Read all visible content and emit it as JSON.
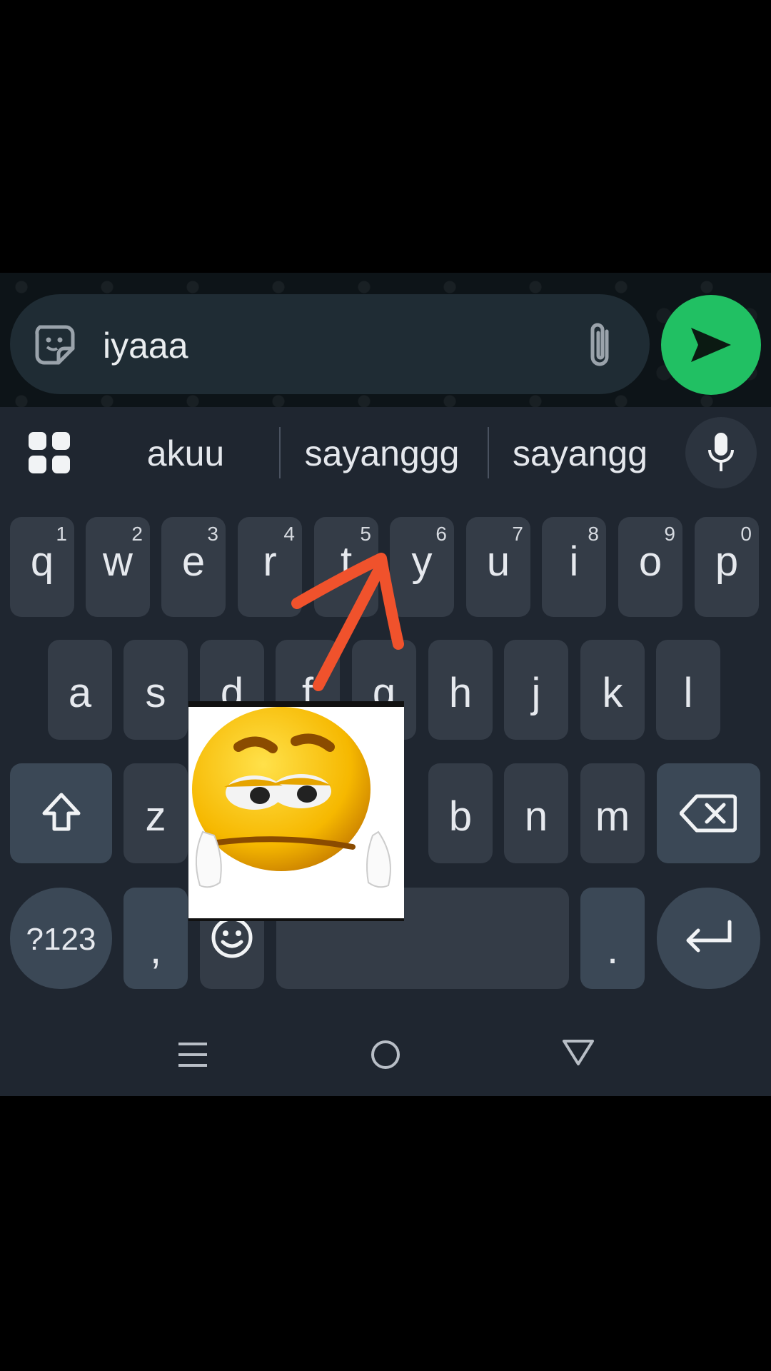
{
  "composer": {
    "message_text": "iyaaa",
    "sticker_icon": "sticker-icon",
    "attach_icon": "paperclip-icon",
    "send_icon": "send-icon",
    "send_color": "#21c063"
  },
  "suggestions": {
    "apps_icon": "apps-grid-icon",
    "items": [
      "akuu",
      "sayanggg",
      "sayangg"
    ],
    "mic_icon": "microphone-icon"
  },
  "keyboard": {
    "row1": [
      {
        "char": "q",
        "num": "1"
      },
      {
        "char": "w",
        "num": "2"
      },
      {
        "char": "e",
        "num": "3"
      },
      {
        "char": "r",
        "num": "4"
      },
      {
        "char": "t",
        "num": "5"
      },
      {
        "char": "y",
        "num": "6"
      },
      {
        "char": "u",
        "num": "7"
      },
      {
        "char": "i",
        "num": "8"
      },
      {
        "char": "o",
        "num": "9"
      },
      {
        "char": "p",
        "num": "0"
      }
    ],
    "row2": [
      "a",
      "s",
      "d",
      "f",
      "g",
      "h",
      "j",
      "k",
      "l"
    ],
    "row3": [
      "z",
      "b",
      "n",
      "m"
    ],
    "symbols_label": "?123",
    "comma_label": ",",
    "period_label": ".",
    "shift_icon": "shift-icon",
    "backspace_icon": "backspace-icon",
    "emoji_icon": "emoji-icon",
    "enter_icon": "enter-icon"
  },
  "nav_bar": {
    "recents_icon": "recents-icon",
    "home_icon": "home-icon",
    "back_icon": "back-icon"
  },
  "overlay": {
    "arrow_color": "#f0522c",
    "sticker_image": "sad-emoji-face-sticker"
  }
}
